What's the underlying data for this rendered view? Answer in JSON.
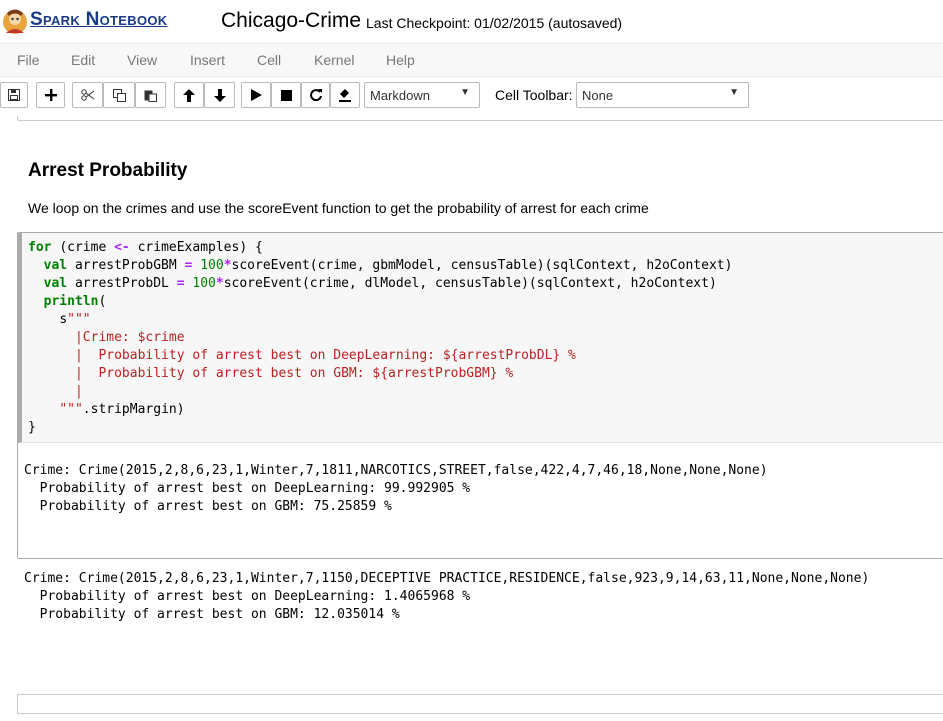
{
  "header": {
    "brand": "Spark Notebook",
    "notebook_title": "Chicago-Crime",
    "checkpoint": "Last Checkpoint: 01/02/2015 (autosaved)"
  },
  "menu": {
    "items": [
      "File",
      "Edit",
      "View",
      "Insert",
      "Cell",
      "Kernel",
      "Help"
    ]
  },
  "toolbar": {
    "cell_type": "Markdown",
    "cell_toolbar_label": "Cell Toolbar:",
    "cell_toolbar_value": "None"
  },
  "markdown": {
    "heading": "Arrest Probability",
    "paragraph": "We loop on the crimes and use the scoreEvent function to get the probability of arrest for each crime"
  },
  "code": {
    "lines": [
      "for (crime <- crimeExamples) {",
      "  val arrestProbGBM = 100*scoreEvent(crime, gbmModel, censusTable)(sqlContext, h2oContext)",
      "  val arrestProbDL = 100*scoreEvent(crime, dlModel, censusTable)(sqlContext, h2oContext)",
      "  println(",
      "    s\"\"\"",
      "      |Crime: $crime",
      "      |  Probability of arrest best on DeepLearning: ${arrestProbDL} %",
      "      |  Probability of arrest best on GBM: ${arrestProbGBM} %",
      "      |",
      "    \"\"\".stripMargin)",
      "}"
    ]
  },
  "output": {
    "lines": [
      "Crime: Crime(2015,2,8,6,23,1,Winter,7,1811,NARCOTICS,STREET,false,422,4,7,46,18,None,None,None)",
      "  Probability of arrest best on DeepLearning: 99.992905 %",
      "  Probability of arrest best on GBM: 75.25859 %",
      "",
      "",
      "",
      "Crime: Crime(2015,2,8,6,23,1,Winter,7,1150,DECEPTIVE PRACTICE,RESIDENCE,false,923,9,14,63,11,None,None,None)",
      "  Probability of arrest best on DeepLearning: 1.4065968 %",
      "  Probability of arrest best on GBM: 12.035014 %"
    ]
  }
}
